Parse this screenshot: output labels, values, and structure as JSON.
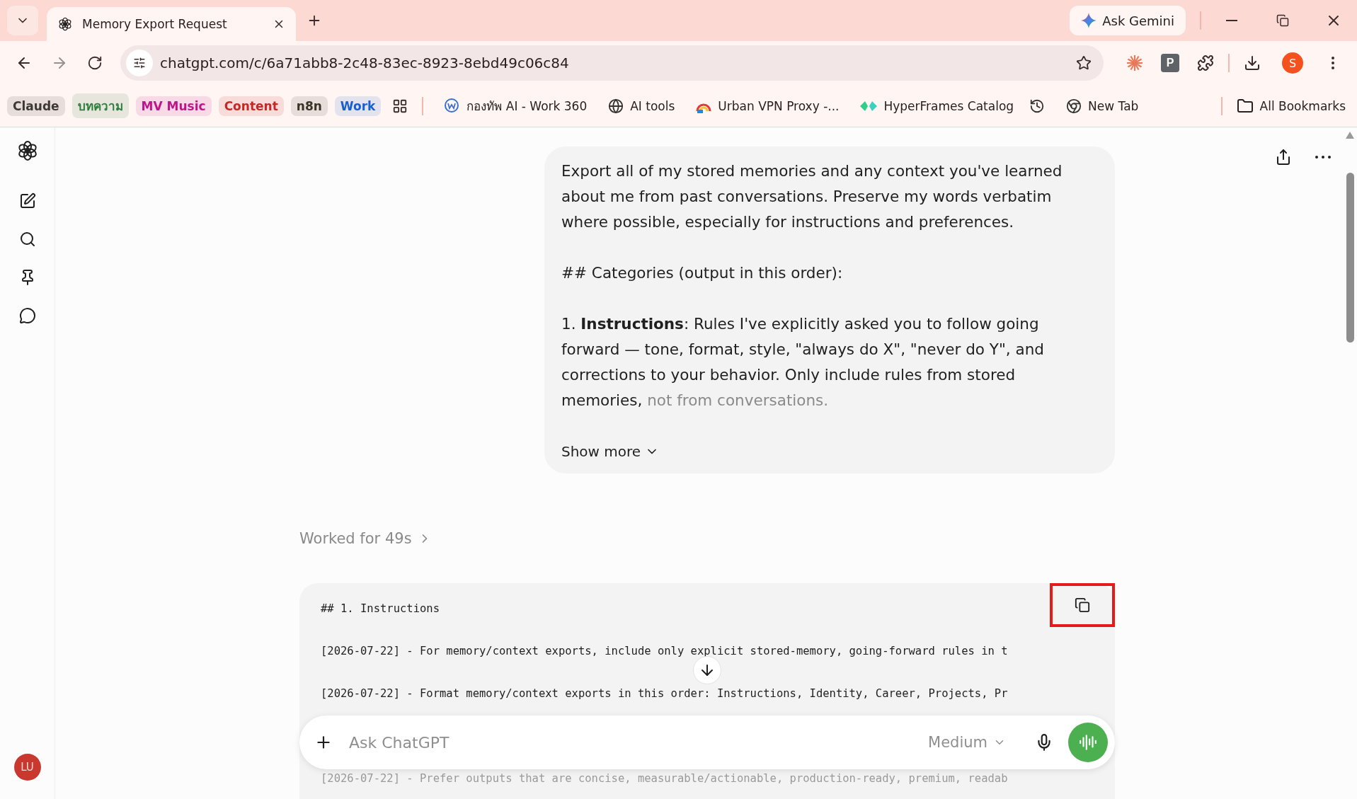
{
  "tab": {
    "title": "Memory Export Request"
  },
  "address": {
    "url": "chatgpt.com/c/6a71abb8-2c48-83ec-8923-8ebd49c06c84"
  },
  "gemini_button": {
    "label": "Ask Gemini"
  },
  "profile": {
    "initial": "S"
  },
  "extension": {
    "letter": "P"
  },
  "bookmark_chips": [
    {
      "label": "Claude",
      "color": "#3d3a36"
    },
    {
      "label": "บทความ",
      "color": "#2e7d3c"
    },
    {
      "label": "MV Music",
      "color": "#c0158a"
    },
    {
      "label": "Content",
      "color": "#c62828"
    },
    {
      "label": "n8n",
      "color": "#3a3428"
    },
    {
      "label": "Work",
      "color": "#1a5fd0"
    }
  ],
  "bookmarks": [
    {
      "kind": "work360",
      "label": "กองทัพ AI - Work 360"
    },
    {
      "kind": "globe",
      "label": "AI tools"
    },
    {
      "kind": "vpn",
      "label": "Urban VPN Proxy -..."
    },
    {
      "kind": "hyper",
      "label": "HyperFrames Catalog"
    },
    {
      "kind": "history"
    },
    {
      "kind": "chrome",
      "label": "New Tab"
    }
  ],
  "all_bookmarks": {
    "label": "All Bookmarks"
  },
  "user": {
    "initials": "LU"
  },
  "message": {
    "paragraphs": [
      {
        "text": "Export all of my stored memories and any context you've learned about me from past conversations. Preserve my words verbatim where possible, especially for instructions and preferences."
      },
      {
        "text": "## Categories (output in this order):"
      },
      {
        "text": "1. **Instructions**: Rules I've explicitly asked you to follow going forward — tone, format, style, \"always do X\", \"never do Y\", and corrections to your behavior. Only include rules from stored memories,",
        "faded_text": "not from conversations."
      }
    ],
    "show_more": "Show more"
  },
  "worked": {
    "label": "Worked for 49s"
  },
  "code": {
    "lines": [
      {
        "text": "## 1. Instructions",
        "faded": false
      },
      {
        "text": "[2026-07-22] - For memory/context exports, include only explicit stored-memory, going-forward rules in t",
        "faded": false
      },
      {
        "text": "[2026-07-22] - Format memory/context exports in this order: Instructions, Identity, Career, Projects, Pr",
        "faded": false
      },
      {
        "text": "[2026-07-22] - Prefer outputs that are concise, measurable/actionable, production-ready, premium, readab",
        "faded": true
      }
    ],
    "copy_highlighted": true
  },
  "composer": {
    "placeholder": "Ask ChatGPT",
    "model": "Medium"
  }
}
